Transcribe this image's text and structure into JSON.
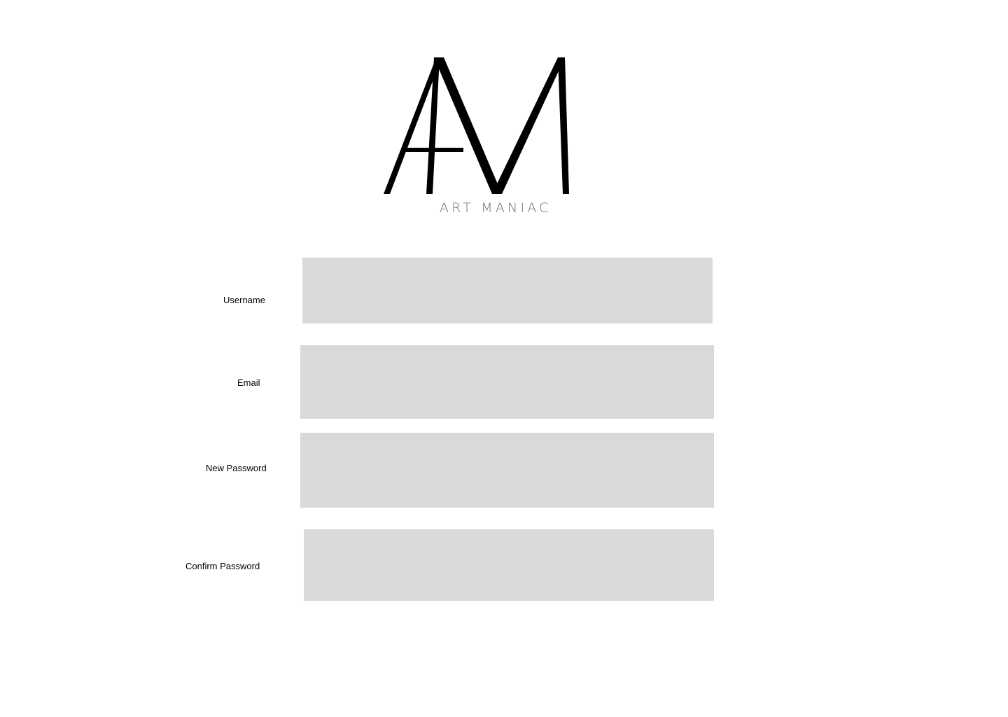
{
  "brand": {
    "monogram": "AM",
    "name": "ART MANIAC",
    "mark_color": "#000000",
    "name_color": "#6f6f6f"
  },
  "form": {
    "fields": [
      {
        "label": "Username",
        "value": "",
        "placeholder": ""
      },
      {
        "label": "Email",
        "value": "",
        "placeholder": ""
      },
      {
        "label": "New Password",
        "value": "",
        "placeholder": ""
      },
      {
        "label": "Confirm Password",
        "value": "",
        "placeholder": ""
      }
    ],
    "input_bg": "#d9d9d9"
  }
}
